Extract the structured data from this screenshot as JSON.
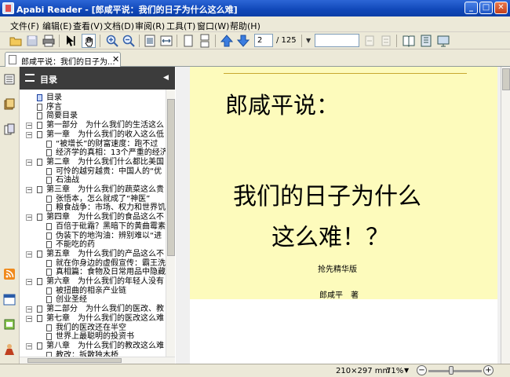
{
  "window": {
    "title": "Apabi Reader - [郎咸平说：我们的日子为什么这么难]",
    "minimize": "_",
    "maximize": "□",
    "close": "✕"
  },
  "menu": [
    "文件(F)",
    "编辑(E)",
    "查看(V)",
    "文档(D)",
    "审阅(R)",
    "工具(T)",
    "窗口(W)",
    "帮助(H)"
  ],
  "toolbar": {
    "current_page": "2",
    "total_pages": "/ 125",
    "search_placeholder": "",
    "icons": [
      "open-icon",
      "save-icon",
      "print-icon",
      "select-icon",
      "hand-icon",
      "zoom-in-icon",
      "zoom-out-icon",
      "fit-page-icon",
      "fit-width-icon",
      "single-page-icon",
      "continuous-page-icon",
      "previous-page-icon",
      "next-page-icon",
      "find-previous-icon",
      "find-next-icon",
      "bookshelf-icon",
      "library-icon",
      "fullscreen-icon"
    ]
  },
  "tab": {
    "label": "郎咸平说：我们的日子为...",
    "close": "✕"
  },
  "sidebar": {
    "title": "目录",
    "collapse": "◀",
    "toc": [
      {
        "label": "目录",
        "level": 0,
        "expander": "",
        "selected": true
      },
      {
        "label": "序言",
        "level": 0,
        "expander": ""
      },
      {
        "label": "简要目录",
        "level": 0,
        "expander": ""
      },
      {
        "label": "第一部分　为什么我们的生活这么",
        "level": 0,
        "expander": "−"
      },
      {
        "label": "第一章　为什么我们的收入这么低",
        "level": 0,
        "expander": "−"
      },
      {
        "label": "“被增长”的财富速度：跑不过",
        "level": 1,
        "expander": ""
      },
      {
        "label": "经济学的真相：13个严重的经济",
        "level": 1,
        "expander": ""
      },
      {
        "label": "第二章　为什么我们什么都比美国",
        "level": 0,
        "expander": "−"
      },
      {
        "label": "可怜的越穷越贵：中国人的“优",
        "level": 1,
        "expander": ""
      },
      {
        "label": "石油战",
        "level": 1,
        "expander": ""
      },
      {
        "label": "第三章　为什么我们的蔬菜这么贵",
        "level": 0,
        "expander": "−"
      },
      {
        "label": "张悟本，怎么就成了“神医”",
        "level": 1,
        "expander": ""
      },
      {
        "label": "粮食战争：市场、权力和世界饥",
        "level": 1,
        "expander": ""
      },
      {
        "label": "第四章　为什么我们的食品这么不",
        "level": 0,
        "expander": "−"
      },
      {
        "label": "百倍于砒霜？黑暗下的黄曲霉素",
        "level": 1,
        "expander": ""
      },
      {
        "label": "伪装下的地沟油：辨别难以“进",
        "level": 1,
        "expander": ""
      },
      {
        "label": "不能吃的药",
        "level": 1,
        "expander": ""
      },
      {
        "label": "第五章　为什么我们的产品这么不",
        "level": 0,
        "expander": "−"
      },
      {
        "label": "就在你身边的虚假宣传：霸王洗",
        "level": 1,
        "expander": ""
      },
      {
        "label": "真相篇：食物及日常用品中隐藏",
        "level": 1,
        "expander": ""
      },
      {
        "label": "第六章　为什么我们的年轻人没有",
        "level": 0,
        "expander": "−"
      },
      {
        "label": "被扭曲的相亲产业链",
        "level": 1,
        "expander": ""
      },
      {
        "label": "创业圣经",
        "level": 1,
        "expander": ""
      },
      {
        "label": "第二部分　为什么我们的医改、教",
        "level": 0,
        "expander": "−"
      },
      {
        "label": "第七章　为什么我们的医改这么难",
        "level": 0,
        "expander": "−"
      },
      {
        "label": "我们的医改还在半空",
        "level": 1,
        "expander": ""
      },
      {
        "label": "世界上最聪明的投资书",
        "level": 1,
        "expander": ""
      },
      {
        "label": "第八章　为什么我们的教改这么难",
        "level": 0,
        "expander": "−"
      },
      {
        "label": "教改：拆散独木桥",
        "level": 1,
        "expander": ""
      }
    ]
  },
  "page": {
    "author_header": "郎咸平说：",
    "title_line1": "我们的日子为什么",
    "title_line2": "这么难！？",
    "edition": "抢先精华版",
    "author": "郎咸平　著"
  },
  "status": {
    "page_size": "210×297 mm",
    "zoom": "71%",
    "zoom_fraction": 0.42,
    "zoom_out": "−",
    "zoom_in": "+"
  },
  "colors": {
    "titlebar": "#1047b8",
    "page_background": "#fdfbbc",
    "sidebar_header": "#3c3c3c"
  }
}
